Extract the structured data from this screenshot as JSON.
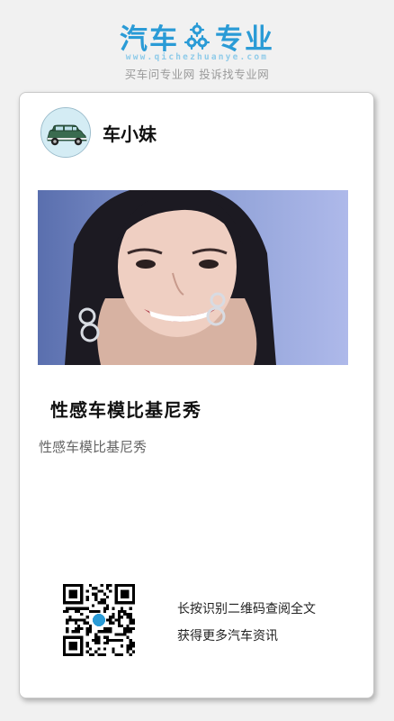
{
  "brand": {
    "logo_left": "汽车",
    "logo_right": "专业",
    "url": "www.qichezhuanye.com",
    "slogan": "买车问专业网 投诉找专业网",
    "color": "#2a9bd6"
  },
  "author": {
    "name": "车小妹",
    "avatar_icon": "car-avatar-icon"
  },
  "article": {
    "title": "性感车模比基尼秀",
    "summary": "性感车模比基尼秀",
    "image_icon": "model-photo"
  },
  "share": {
    "qr_icon": "qr-code-icon",
    "line1": "长按识别二维码查阅全文",
    "line2": "获得更多汽车资讯"
  }
}
